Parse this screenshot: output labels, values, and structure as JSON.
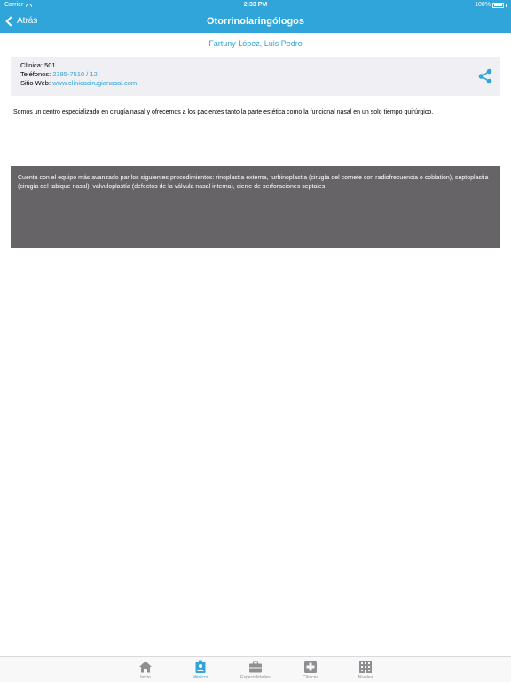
{
  "status_bar": {
    "carrier": "Carrier",
    "time": "2:33 PM",
    "battery": "100%"
  },
  "nav": {
    "back_label": "Atrás",
    "title": "Otorrinolaringólogos"
  },
  "doctor_name": "Fartuny López, Luis Pedro",
  "info": {
    "clinic_label": "Clínica:",
    "clinic_value": "501",
    "phones_label": "Teléfonos:",
    "phones_value": "2385-7510 / 12",
    "website_label": "Sitio Web:",
    "website_value": "www.clinicacirugianasal.com"
  },
  "description": "Somos un centro especializado en cirugía nasal y ofrecemos a los pacientes tanto la parte estética como la funcional nasal en un solo tiempo quirúrgico.",
  "procedures_text": "Cuenta con el equipo más avanzado par los siguientes procedimientos: rinoplastia externa, turbinoplastia (cirugía del cornete con radiofrecuencia o coblation), septoplastia (cirugía del tabique nasal), valvuloplastía (defectos de la válvula nasal interna), cierre de perforaciones septales.",
  "tabs": [
    {
      "label": "Inicio",
      "icon": "home-icon"
    },
    {
      "label": "Médicos",
      "icon": "doctor-badge-icon"
    },
    {
      "label": "Especialidades",
      "icon": "briefcase-icon"
    },
    {
      "label": "Clínicas",
      "icon": "medical-cross-icon"
    },
    {
      "label": "Niveles",
      "icon": "building-icon"
    }
  ],
  "active_tab": "Médicos",
  "colors": {
    "accent": "#2fa5d9",
    "panel": "#666466",
    "card": "#efeff4",
    "tab_inactive": "#8e8e93"
  }
}
